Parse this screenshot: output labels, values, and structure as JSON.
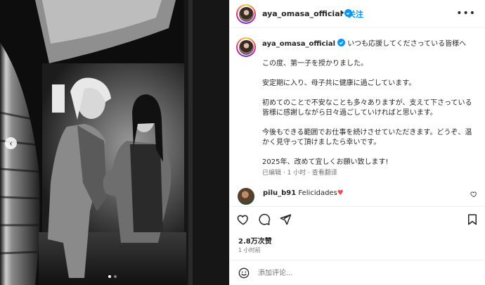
{
  "post": {
    "photo": {
      "alt": "black-and-white photo of a couple",
      "slide_count": 2,
      "active_slide": 1
    }
  },
  "header": {
    "username": "aya_omasa_official",
    "separator": "•",
    "follow_label": "关注",
    "more_label": "•••"
  },
  "caption": {
    "username": "aya_omasa_official",
    "first_line": "いつも応援してくださっている皆様へ",
    "paragraphs": [
      "この度、第一子を授かりました。",
      "安定期に入り、母子共に健康に過ごしています。",
      "初めてのことで不安なことも多々ありますが、支えて下さっている皆様に感謝しながら日々過ごしていければと思います。",
      "今後もできる範囲でお仕事を続けさせていただきます。どうぞ、温かく見守って頂けましたら幸いです。",
      "2025年、改めて宜しくお願い致します!"
    ],
    "meta": "已编辑 · 1 小时 · 查看翻译"
  },
  "comments": [
    {
      "username": "pilu_b91",
      "text": "Felicidades",
      "emoji": "♥"
    }
  ],
  "stats": {
    "likes": "2.8万次赞",
    "time_ago": "1 小时前"
  },
  "comment_box": {
    "emoji_icon": "smiley-icon",
    "placeholder": "添加评论..."
  },
  "colors": {
    "accent": "#0095f6",
    "heart": "#ed4956",
    "text": "#262626",
    "muted": "#737373"
  }
}
